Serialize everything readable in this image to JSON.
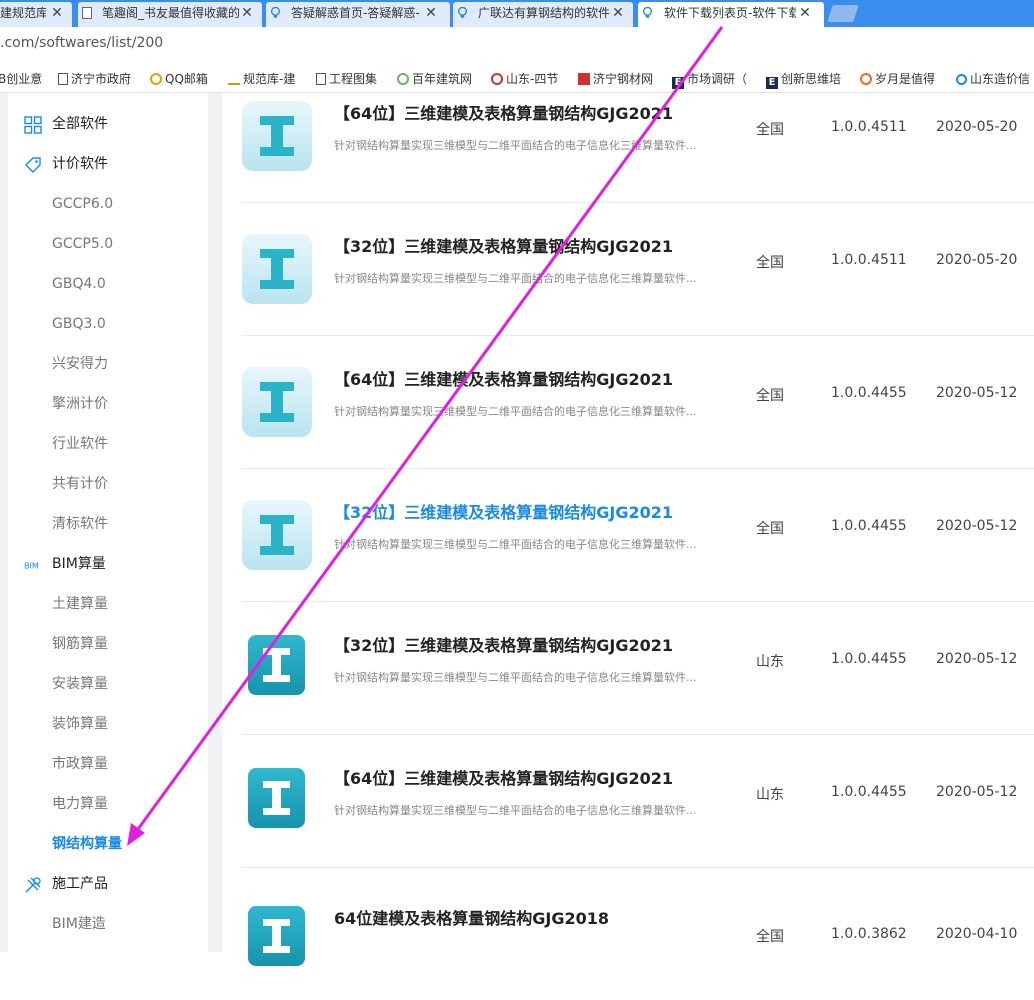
{
  "browser": {
    "tabs": [
      {
        "title": "建规范库-",
        "icon": "page-icon"
      },
      {
        "title": "笔趣阁_书友最值得收藏的",
        "icon": "document-icon"
      },
      {
        "title": "答疑解惑首页-答疑解惑-",
        "icon": "lightbulb-icon"
      },
      {
        "title": "广联达有算钢结构的软件",
        "icon": "lightbulb-icon"
      },
      {
        "title": "软件下载列表页-软件下载",
        "icon": "lightbulb-icon",
        "active": true
      }
    ],
    "address": ".com/softwares/list/200",
    "bookmarks": [
      {
        "label": "B创业意",
        "icon": "none"
      },
      {
        "label": "济宁市政府",
        "icon": "document-icon"
      },
      {
        "label": "QQ邮箱",
        "icon": "qq-mail-icon"
      },
      {
        "label": "规范库-建",
        "icon": "library-icon"
      },
      {
        "label": "工程图集",
        "icon": "document-icon"
      },
      {
        "label": "百年建筑网",
        "icon": "leaf-icon"
      },
      {
        "label": "山东-四节",
        "icon": "weibo-icon"
      },
      {
        "label": "济宁钢材网",
        "icon": "steel-icon"
      },
      {
        "label": "市场调研（",
        "icon": "e-icon"
      },
      {
        "label": "创新思维培",
        "icon": "e-icon"
      },
      {
        "label": "岁月是值得",
        "icon": "sogou-icon"
      },
      {
        "label": "山东造价信",
        "icon": "circle-icon"
      }
    ]
  },
  "sidebar": {
    "items": [
      {
        "label": "全部软件",
        "type": "parent",
        "icon": "grid-icon"
      },
      {
        "label": "计价软件",
        "type": "parent",
        "icon": "price-tag-icon"
      },
      {
        "label": "GCCP6.0",
        "type": "child"
      },
      {
        "label": "GCCP5.0",
        "type": "child"
      },
      {
        "label": "GBQ4.0",
        "type": "child"
      },
      {
        "label": "GBQ3.0",
        "type": "child"
      },
      {
        "label": "兴安得力",
        "type": "child"
      },
      {
        "label": "擎洲计价",
        "type": "child"
      },
      {
        "label": "行业软件",
        "type": "child"
      },
      {
        "label": "共有计价",
        "type": "child"
      },
      {
        "label": "清标软件",
        "type": "child"
      },
      {
        "label": "BIM算量",
        "type": "parent",
        "icon": "bim-icon"
      },
      {
        "label": "土建算量",
        "type": "child"
      },
      {
        "label": "钢筋算量",
        "type": "child"
      },
      {
        "label": "安装算量",
        "type": "child"
      },
      {
        "label": "装饰算量",
        "type": "child"
      },
      {
        "label": "市政算量",
        "type": "child"
      },
      {
        "label": "电力算量",
        "type": "child"
      },
      {
        "label": "钢结构算量",
        "type": "child",
        "active": true
      },
      {
        "label": "施工产品",
        "type": "parent",
        "icon": "tools-icon"
      },
      {
        "label": "BIM建造",
        "type": "child"
      }
    ]
  },
  "software_list": [
    {
      "title": "【64位】三维建模及表格算量钢结构GJG2021",
      "desc": "针对钢结构算量实现三维模型与二维平面结合的电子信息化三维算量软件...",
      "region": "全国",
      "version": "1.0.0.4511",
      "date": "2020-05-20",
      "logo": "light",
      "hover": false
    },
    {
      "title": "【32位】三维建模及表格算量钢结构GJG2021",
      "desc": "针对钢结构算量实现三维模型与二维平面结合的电子信息化三维算量软件...",
      "region": "全国",
      "version": "1.0.0.4511",
      "date": "2020-05-20",
      "logo": "light",
      "hover": false
    },
    {
      "title": "【64位】三维建模及表格算量钢结构GJG2021",
      "desc": "针对钢结构算量实现三维模型与二维平面结合的电子信息化三维算量软件...",
      "region": "全国",
      "version": "1.0.0.4455",
      "date": "2020-05-12",
      "logo": "light",
      "hover": false
    },
    {
      "title": "【32位】三维建模及表格算量钢结构GJG2021",
      "desc": "针对钢结构算量实现三维模型与二维平面结合的电子信息化三维算量软件...",
      "region": "全国",
      "version": "1.0.0.4455",
      "date": "2020-05-12",
      "logo": "light",
      "hover": true
    },
    {
      "title": "【32位】三维建模及表格算量钢结构GJG2021",
      "desc": "针对钢结构算量实现三维模型与二维平面结合的电子信息化三维算量软件...",
      "region": "山东",
      "version": "1.0.0.4455",
      "date": "2020-05-12",
      "logo": "dark",
      "hover": false
    },
    {
      "title": "【64位】三维建模及表格算量钢结构GJG2021",
      "desc": "针对钢结构算量实现三维模型与二维平面结合的电子信息化三维算量软件...",
      "region": "山东",
      "version": "1.0.0.4455",
      "date": "2020-05-12",
      "logo": "dark",
      "hover": false
    },
    {
      "title": "64位建模及表格算量钢结构GJG2018",
      "desc": "",
      "region": "全国",
      "version": "1.0.0.3862",
      "date": "2020-04-10",
      "logo": "dark",
      "hover": false
    }
  ],
  "colors": {
    "accent": "#1a8ae8",
    "tabbar": "#3b8ded",
    "annotation_arrow": "#e020e0"
  }
}
